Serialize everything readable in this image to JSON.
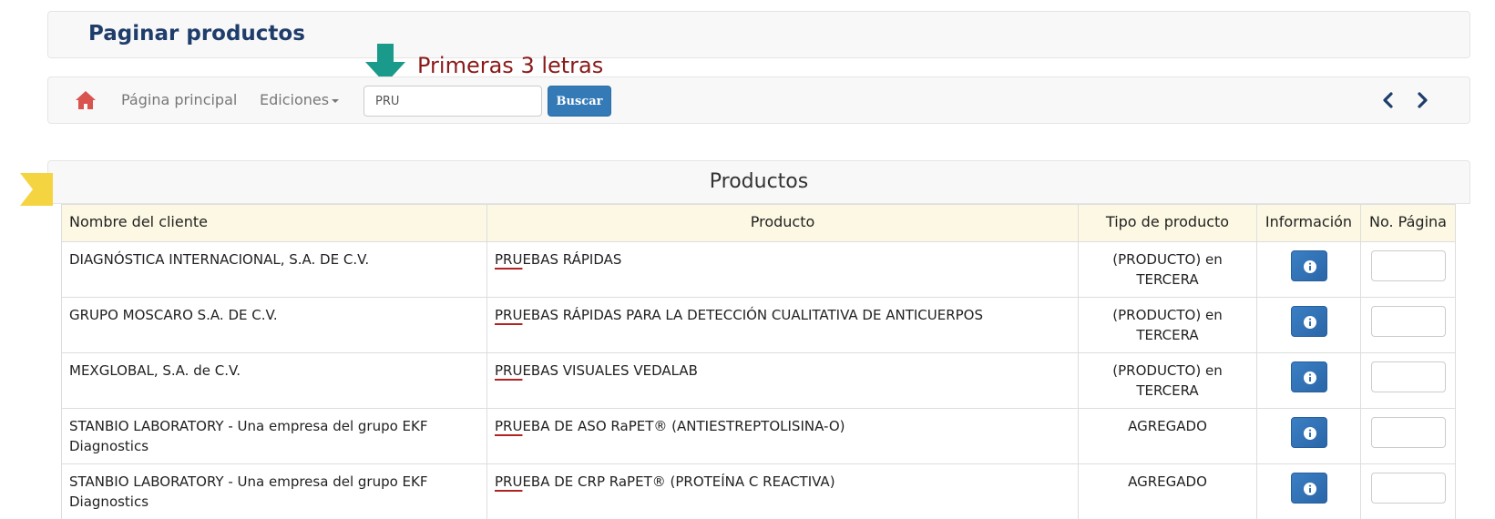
{
  "header": {
    "title": "Paginar productos"
  },
  "annotation": {
    "text": "Primeras 3 letras"
  },
  "navbar": {
    "home_icon": "home-icon",
    "main_label": "Página principal",
    "editions_label": "Ediciones",
    "search_value": "PRU",
    "search_button": "Buscar",
    "prev_icon": "chevron-left-icon",
    "next_icon": "chevron-right-icon"
  },
  "products": {
    "title": "Productos",
    "columns": [
      "Nombre del cliente",
      "Producto",
      "Tipo de producto",
      "Información",
      "No. Página"
    ],
    "rows": [
      {
        "client": "DIAGNÓSTICA INTERNACIONAL, S.A. DE C.V.",
        "product_prefix": "PRU",
        "product_rest": "EBAS RÁPIDAS",
        "type": "(PRODUCTO) en TERCERA",
        "page": ""
      },
      {
        "client": "GRUPO MOSCARO S.A. DE C.V.",
        "product_prefix": "PRU",
        "product_rest": "EBAS RÁPIDAS PARA LA DETECCIÓN CUALITATIVA DE ANTICUERPOS",
        "type": "(PRODUCTO) en TERCERA",
        "page": ""
      },
      {
        "client": "MEXGLOBAL, S.A. de C.V.",
        "product_prefix": "PRU",
        "product_rest": "EBAS VISUALES VEDALAB",
        "type": "(PRODUCTO) en TERCERA",
        "page": ""
      },
      {
        "client": "STANBIO LABORATORY - Una empresa del grupo EKF Diagnostics",
        "product_prefix": "PRU",
        "product_rest": "EBA DE ASO RaPET® (ANTIESTREPTOLISINA-O)",
        "type": "AGREGADO",
        "page": ""
      },
      {
        "client": "STANBIO LABORATORY - Una empresa del grupo EKF Diagnostics",
        "product_prefix": "PRU",
        "product_rest": "EBA DE CRP RaPET® (PROTEÍNA C REACTIVA)",
        "type": "AGREGADO",
        "page": ""
      }
    ]
  },
  "colors": {
    "primary": "#337ab7",
    "title": "#1f3d6b",
    "annotation": "#8b1a1a",
    "arrow": "#1a9a8a",
    "home": "#d9534f",
    "header_row": "#fcf8e3",
    "ribbon": "#f5d442"
  }
}
